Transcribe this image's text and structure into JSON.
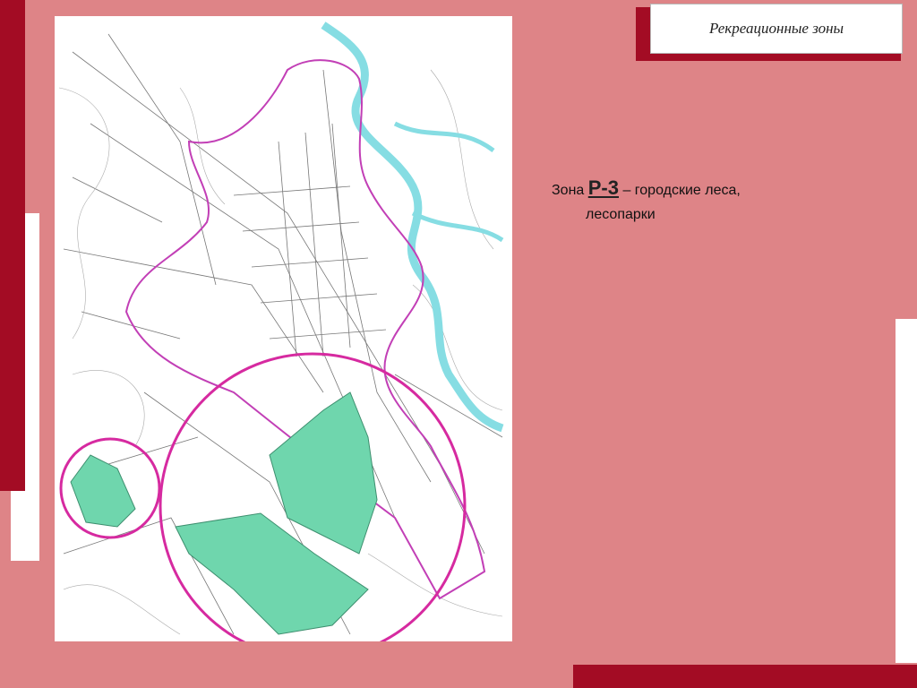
{
  "slide": {
    "title": "Рекреационные зоны",
    "zone_prefix": "Зона",
    "zone_code": "Р-3",
    "zone_desc_line1": "– городские леса,",
    "zone_desc_line2": "лесопарки"
  },
  "colors": {
    "background": "#de8487",
    "accent_dark_red": "#a30c24",
    "highlight_circle": "#d62aa0",
    "forest_fill": "#6fd6ad",
    "river": "#86dde3",
    "boundary": "#c23fb6"
  },
  "map": {
    "type": "city master plan map",
    "highlighted_zone": "Р-3",
    "highlight_regions": 2
  }
}
